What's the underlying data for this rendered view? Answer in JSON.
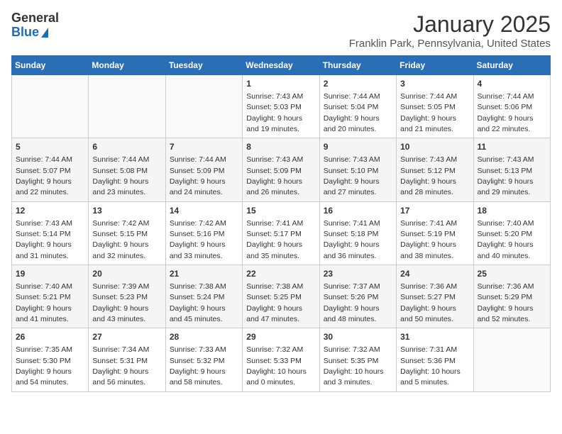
{
  "logo": {
    "line1": "General",
    "line2": "Blue"
  },
  "title": "January 2025",
  "subtitle": "Franklin Park, Pennsylvania, United States",
  "days_of_week": [
    "Sunday",
    "Monday",
    "Tuesday",
    "Wednesday",
    "Thursday",
    "Friday",
    "Saturday"
  ],
  "weeks": [
    [
      {
        "day": "",
        "info": ""
      },
      {
        "day": "",
        "info": ""
      },
      {
        "day": "",
        "info": ""
      },
      {
        "day": "1",
        "info": "Sunrise: 7:43 AM\nSunset: 5:03 PM\nDaylight: 9 hours and 19 minutes."
      },
      {
        "day": "2",
        "info": "Sunrise: 7:44 AM\nSunset: 5:04 PM\nDaylight: 9 hours and 20 minutes."
      },
      {
        "day": "3",
        "info": "Sunrise: 7:44 AM\nSunset: 5:05 PM\nDaylight: 9 hours and 21 minutes."
      },
      {
        "day": "4",
        "info": "Sunrise: 7:44 AM\nSunset: 5:06 PM\nDaylight: 9 hours and 22 minutes."
      }
    ],
    [
      {
        "day": "5",
        "info": "Sunrise: 7:44 AM\nSunset: 5:07 PM\nDaylight: 9 hours and 22 minutes."
      },
      {
        "day": "6",
        "info": "Sunrise: 7:44 AM\nSunset: 5:08 PM\nDaylight: 9 hours and 23 minutes."
      },
      {
        "day": "7",
        "info": "Sunrise: 7:44 AM\nSunset: 5:09 PM\nDaylight: 9 hours and 24 minutes."
      },
      {
        "day": "8",
        "info": "Sunrise: 7:43 AM\nSunset: 5:09 PM\nDaylight: 9 hours and 26 minutes."
      },
      {
        "day": "9",
        "info": "Sunrise: 7:43 AM\nSunset: 5:10 PM\nDaylight: 9 hours and 27 minutes."
      },
      {
        "day": "10",
        "info": "Sunrise: 7:43 AM\nSunset: 5:12 PM\nDaylight: 9 hours and 28 minutes."
      },
      {
        "day": "11",
        "info": "Sunrise: 7:43 AM\nSunset: 5:13 PM\nDaylight: 9 hours and 29 minutes."
      }
    ],
    [
      {
        "day": "12",
        "info": "Sunrise: 7:43 AM\nSunset: 5:14 PM\nDaylight: 9 hours and 31 minutes."
      },
      {
        "day": "13",
        "info": "Sunrise: 7:42 AM\nSunset: 5:15 PM\nDaylight: 9 hours and 32 minutes."
      },
      {
        "day": "14",
        "info": "Sunrise: 7:42 AM\nSunset: 5:16 PM\nDaylight: 9 hours and 33 minutes."
      },
      {
        "day": "15",
        "info": "Sunrise: 7:41 AM\nSunset: 5:17 PM\nDaylight: 9 hours and 35 minutes."
      },
      {
        "day": "16",
        "info": "Sunrise: 7:41 AM\nSunset: 5:18 PM\nDaylight: 9 hours and 36 minutes."
      },
      {
        "day": "17",
        "info": "Sunrise: 7:41 AM\nSunset: 5:19 PM\nDaylight: 9 hours and 38 minutes."
      },
      {
        "day": "18",
        "info": "Sunrise: 7:40 AM\nSunset: 5:20 PM\nDaylight: 9 hours and 40 minutes."
      }
    ],
    [
      {
        "day": "19",
        "info": "Sunrise: 7:40 AM\nSunset: 5:21 PM\nDaylight: 9 hours and 41 minutes."
      },
      {
        "day": "20",
        "info": "Sunrise: 7:39 AM\nSunset: 5:23 PM\nDaylight: 9 hours and 43 minutes."
      },
      {
        "day": "21",
        "info": "Sunrise: 7:38 AM\nSunset: 5:24 PM\nDaylight: 9 hours and 45 minutes."
      },
      {
        "day": "22",
        "info": "Sunrise: 7:38 AM\nSunset: 5:25 PM\nDaylight: 9 hours and 47 minutes."
      },
      {
        "day": "23",
        "info": "Sunrise: 7:37 AM\nSunset: 5:26 PM\nDaylight: 9 hours and 48 minutes."
      },
      {
        "day": "24",
        "info": "Sunrise: 7:36 AM\nSunset: 5:27 PM\nDaylight: 9 hours and 50 minutes."
      },
      {
        "day": "25",
        "info": "Sunrise: 7:36 AM\nSunset: 5:29 PM\nDaylight: 9 hours and 52 minutes."
      }
    ],
    [
      {
        "day": "26",
        "info": "Sunrise: 7:35 AM\nSunset: 5:30 PM\nDaylight: 9 hours and 54 minutes."
      },
      {
        "day": "27",
        "info": "Sunrise: 7:34 AM\nSunset: 5:31 PM\nDaylight: 9 hours and 56 minutes."
      },
      {
        "day": "28",
        "info": "Sunrise: 7:33 AM\nSunset: 5:32 PM\nDaylight: 9 hours and 58 minutes."
      },
      {
        "day": "29",
        "info": "Sunrise: 7:32 AM\nSunset: 5:33 PM\nDaylight: 10 hours and 0 minutes."
      },
      {
        "day": "30",
        "info": "Sunrise: 7:32 AM\nSunset: 5:35 PM\nDaylight: 10 hours and 3 minutes."
      },
      {
        "day": "31",
        "info": "Sunrise: 7:31 AM\nSunset: 5:36 PM\nDaylight: 10 hours and 5 minutes."
      },
      {
        "day": "",
        "info": ""
      }
    ]
  ]
}
